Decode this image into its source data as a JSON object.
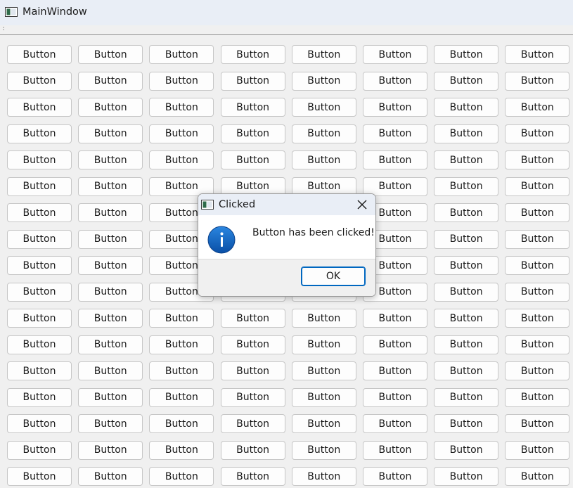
{
  "window": {
    "title": "MainWindow",
    "icon": "app-window-icon"
  },
  "grid": {
    "columns": 8,
    "rows": 17,
    "button_label": "Button"
  },
  "dialog": {
    "title": "Clicked",
    "icon": "app-window-icon",
    "message": "Button has been clicked!",
    "info_icon": "information-icon",
    "ok_label": "OK",
    "close_icon": "close-icon"
  },
  "colors": {
    "titlebar": "#e9eef6",
    "background": "#f0f0f0",
    "accent": "#0067c0",
    "info_icon": "#0b5cb8"
  }
}
